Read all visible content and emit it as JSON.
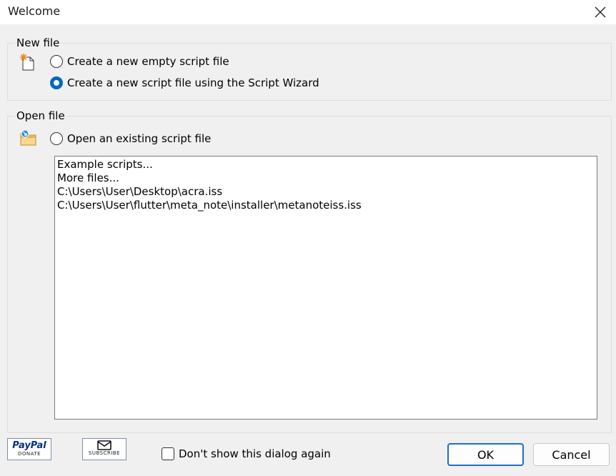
{
  "window": {
    "title": "Welcome",
    "close_icon": "close-icon"
  },
  "new_file": {
    "group_label": "New file",
    "icon": "new-document-icon",
    "option_empty": "Create a new empty script file",
    "option_wizard": "Create a new script file using the Script Wizard",
    "selected": "wizard"
  },
  "open_file": {
    "group_label": "Open file",
    "icon": "open-folder-icon",
    "option_existing": "Open an existing script file",
    "files": [
      "Example scripts...",
      "More files...",
      "C:\\Users\\User\\Desktop\\acra.iss",
      "C:\\Users\\User\\flutter\\meta_note\\installer\\metanoteiss.iss"
    ]
  },
  "footer": {
    "paypal_logo": "PayPal",
    "paypal_caption": "DONATE",
    "subscribe_caption": "SUBSCRIBE",
    "dont_show_label": "Don't show this dialog again",
    "dont_show_checked": false,
    "ok_label": "OK",
    "cancel_label": "Cancel"
  },
  "colors": {
    "accent": "#0067c0",
    "background": "#f0f0f0",
    "paypal_blue": "#003087",
    "paypal_light_blue": "#009cde"
  }
}
